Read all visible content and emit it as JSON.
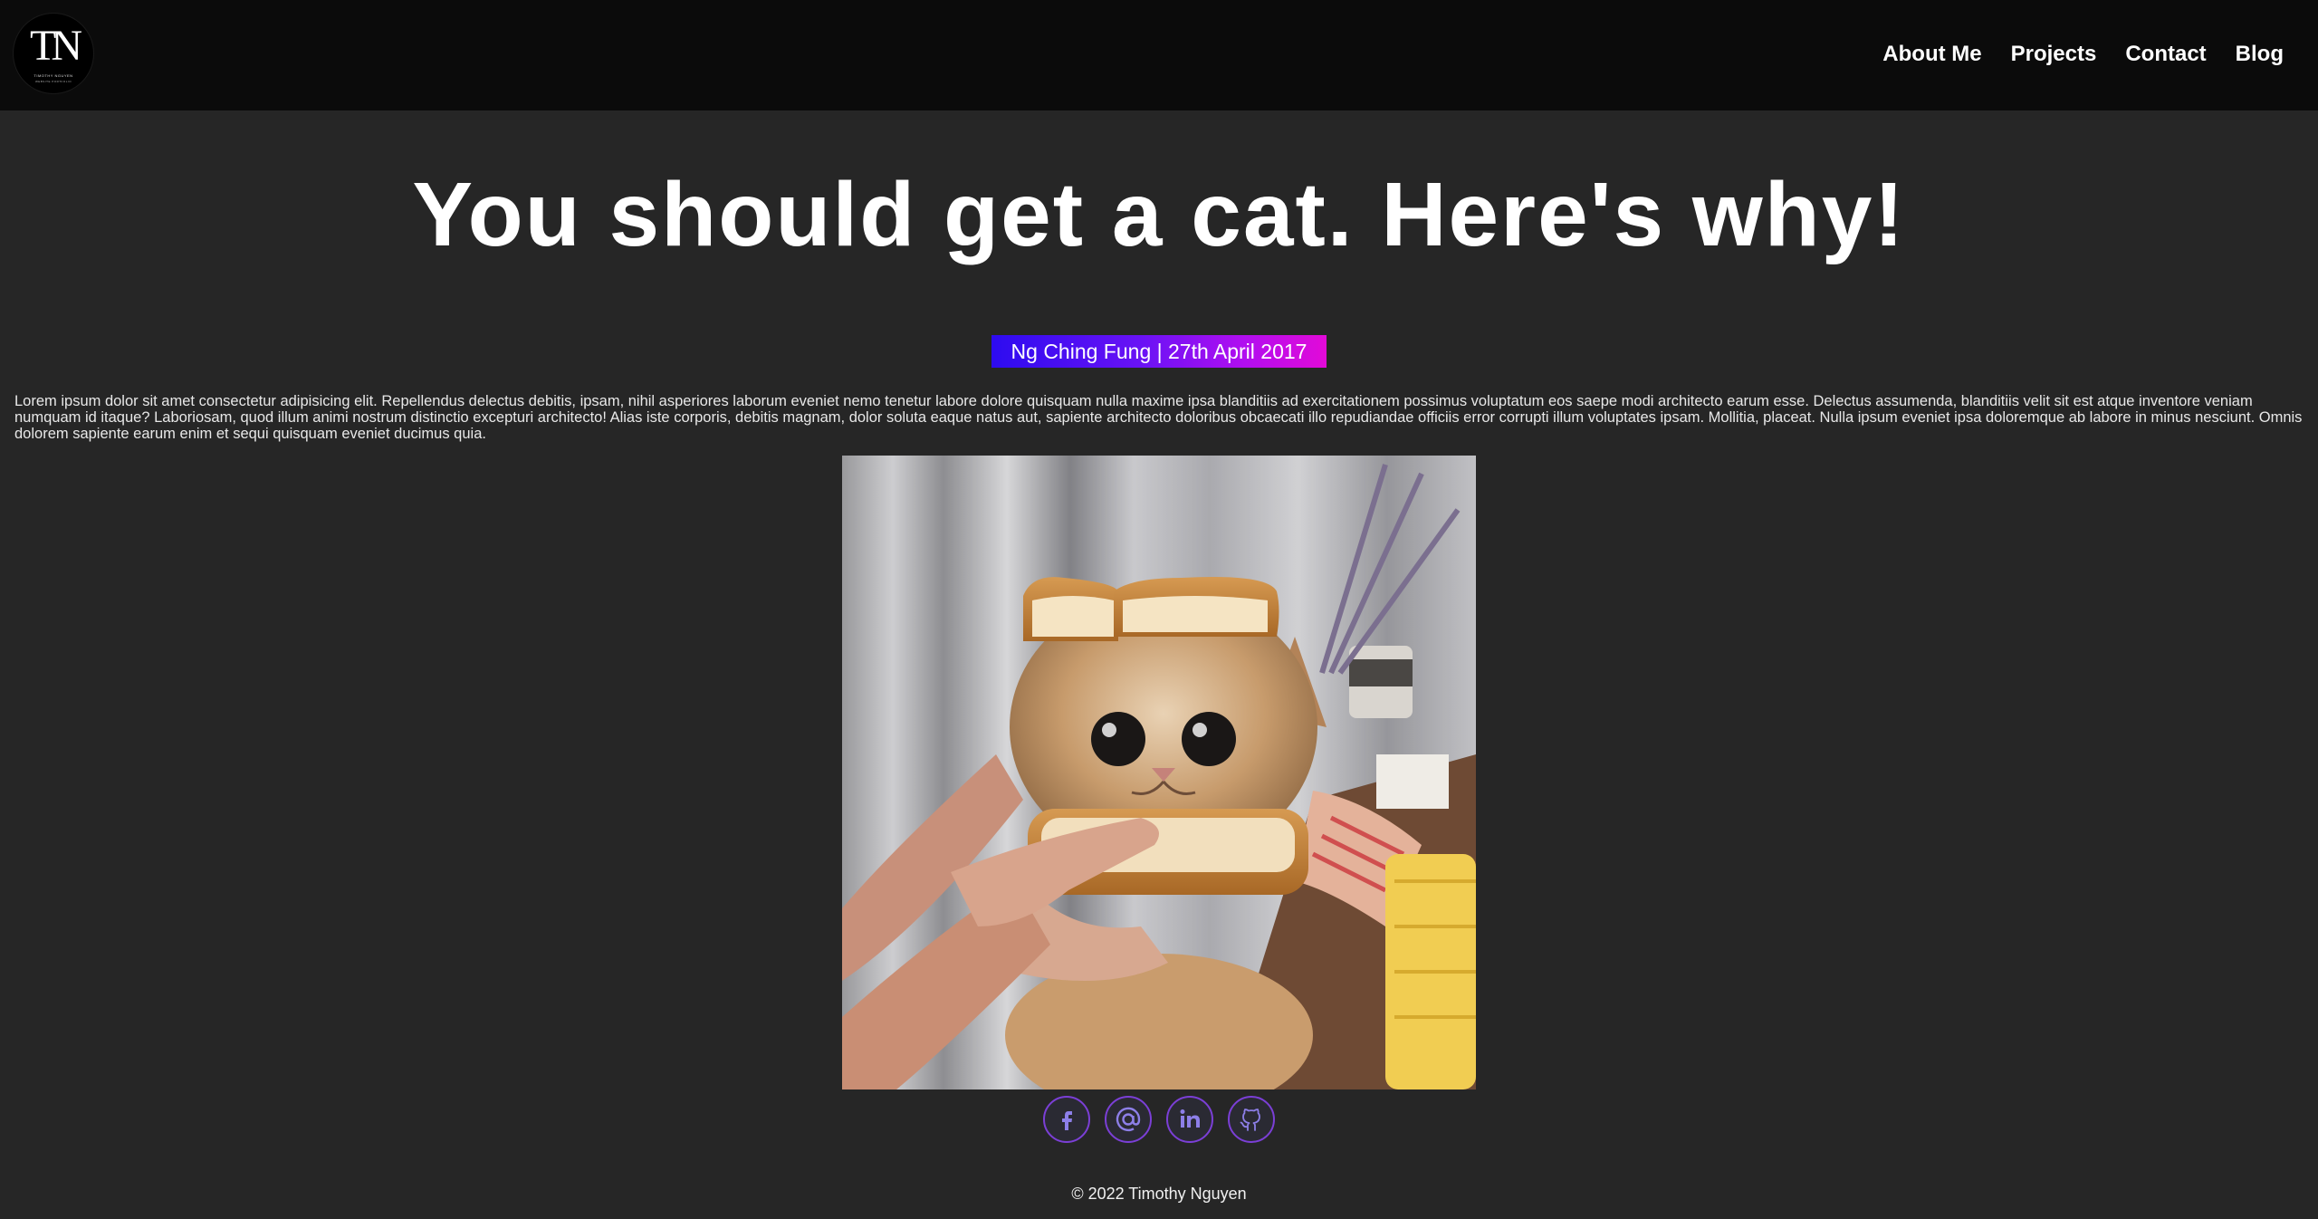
{
  "header": {
    "logo": {
      "mark": "TN",
      "line1": "TIMOTHY NGUYEN",
      "line2": "WEBSITE PORTFOLIO"
    },
    "nav": [
      {
        "label": "About Me"
      },
      {
        "label": "Projects"
      },
      {
        "label": "Contact"
      },
      {
        "label": "Blog"
      }
    ]
  },
  "article": {
    "title": "You should get a cat. Here's why!",
    "byline": "Ng Ching Fung | 27th April 2017",
    "body": "Lorem ipsum dolor sit amet consectetur adipisicing elit. Repellendus delectus debitis, ipsam, nihil asperiores laborum eveniet nemo tenetur labore dolore quisquam nulla maxime ipsa blanditiis ad exercitationem possimus voluptatum eos saepe modi architecto earum esse. Delectus assumenda, blanditiis velit sit est atque inventore veniam numquam id itaque? Laboriosam, quod illum animi nostrum distinctio excepturi architecto! Alias iste corporis, debitis magnam, dolor soluta eaque natus aut, sapiente architecto doloribus obcaecati illo repudiandae officiis error corrupti illum voluptates ipsam. Mollitia, placeat. Nulla ipsum eveniet ipsa doloremque ab labore in minus nesciunt. Omnis dolorem sapiente earum enim et sequi quisquam eveniet ducimus quia.",
    "image_icon": "cat-photo"
  },
  "socials": [
    {
      "icon": "facebook-icon"
    },
    {
      "icon": "email-icon"
    },
    {
      "icon": "linkedin-icon"
    },
    {
      "icon": "github-icon"
    }
  ],
  "footer": {
    "copyright": "© 2022 Timothy Nguyen"
  },
  "colors": {
    "page_bg": "#262626",
    "header_bg": "#0b0b0b",
    "byline_gradient_start": "#2d0bf0",
    "byline_gradient_end": "#e20ad8",
    "social_border": "#7b3fd6"
  }
}
